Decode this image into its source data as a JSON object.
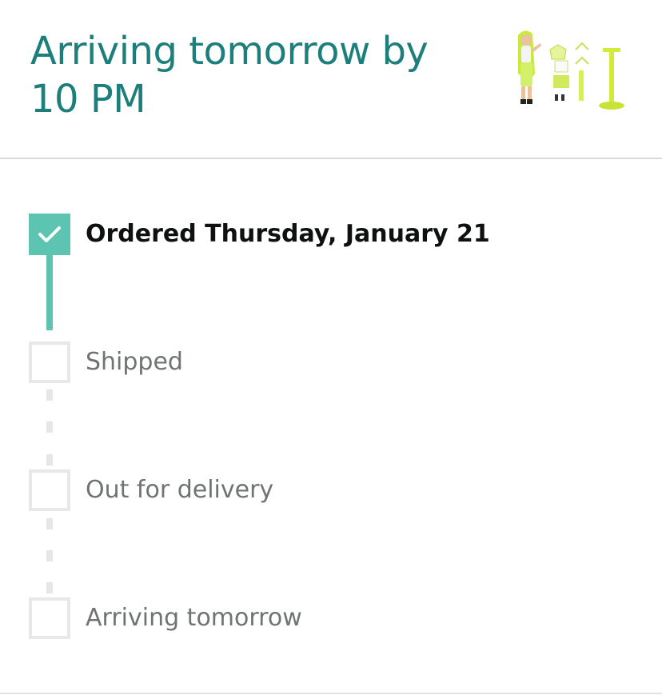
{
  "header": {
    "title_line1": "Arriving tomorrow by",
    "title_line2": "10 PM",
    "accent_color": "#1c7f7b",
    "product_image": "doll-set-thumbnail"
  },
  "tracker": {
    "progress_color": "#5cc4b1",
    "steps": [
      {
        "label": "Ordered Thursday, January 21",
        "completed": true
      },
      {
        "label": "Shipped",
        "completed": false
      },
      {
        "label": "Out for delivery",
        "completed": false
      },
      {
        "label": "Arriving tomorrow",
        "completed": false
      }
    ]
  }
}
